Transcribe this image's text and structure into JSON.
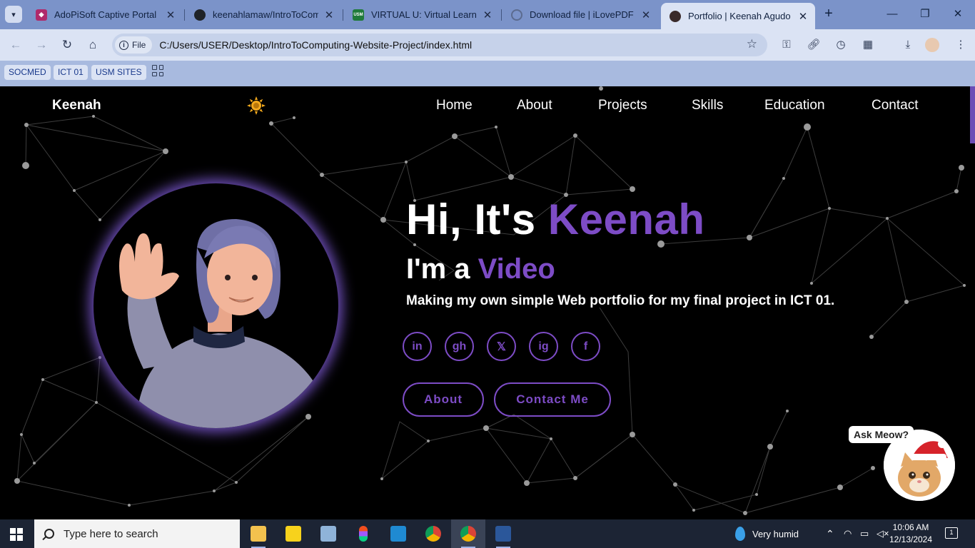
{
  "browser": {
    "tabs": [
      {
        "title": "AdoPiSoft Captive Portal",
        "active": false,
        "favicon_color": "#b02a6b"
      },
      {
        "title": "keenahlamaw/IntroToCompu",
        "active": false,
        "favicon_color": "#1f2328"
      },
      {
        "title": "VIRTUAL U: Virtual Learning",
        "active": false,
        "favicon_color": "#1f7a3a"
      },
      {
        "title": "Download file | iLovePDF",
        "active": false,
        "favicon_color": "#5b6b8f"
      },
      {
        "title": "Portfolio | Keenah Agudo",
        "active": true,
        "favicon_color": "#3a2a2a"
      }
    ],
    "address": {
      "scheme_chip": "File",
      "url": "C:/Users/USER/Desktop/IntroToComputing-Website-Project/index.html"
    },
    "bookmarks": [
      "SOCMED",
      "ICT 01",
      "USM SITES"
    ],
    "bookmark_badge_text": "USM"
  },
  "site": {
    "logo": "Keenah",
    "theme_toggle_icon": "sun-icon",
    "nav": [
      "Home",
      "About",
      "Projects",
      "Skills",
      "Education",
      "Contact"
    ],
    "hero": {
      "greeting_prefix": "Hi, It's ",
      "greeting_name": "Keenah",
      "role_prefix": "I'm a ",
      "role_word": "Video",
      "description": "Making my own simple Web portfolio for my final project in ICT 01."
    },
    "social": [
      {
        "name": "linkedin-icon",
        "glyph": "in"
      },
      {
        "name": "github-icon",
        "glyph": "gh"
      },
      {
        "name": "x-icon",
        "glyph": "𝕏"
      },
      {
        "name": "instagram-icon",
        "glyph": "ig"
      },
      {
        "name": "facebook-icon",
        "glyph": "f"
      }
    ],
    "buttons": {
      "about": "About",
      "contact": "Contact Me"
    },
    "chatbot": {
      "bubble": "Ask Meow?"
    },
    "colors": {
      "accent": "#7d4cc6",
      "background": "#000000",
      "sun": "#f2a81d"
    }
  },
  "taskbar": {
    "search_placeholder": "Type here to search",
    "weather": "Very humid",
    "time": "10:06 AM",
    "date": "12/13/2024",
    "notification_count": "1"
  }
}
